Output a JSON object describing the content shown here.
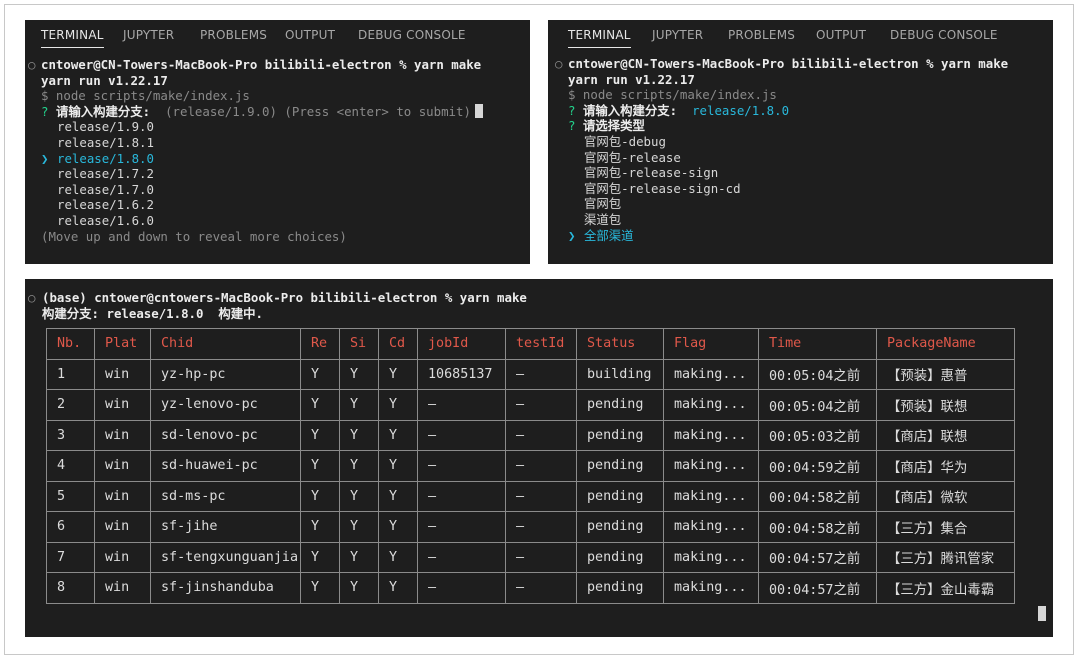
{
  "tabs": [
    "TERMINAL",
    "JUPYTER",
    "PROBLEMS",
    "OUTPUT",
    "DEBUG CONSOLE"
  ],
  "panel1": {
    "prompt": "cntower@CN-Towers-MacBook-Pro bilibili-electron % yarn make",
    "yarn": "yarn run v1.22.17",
    "node": "$ node scripts/make/index.js",
    "q_mark": "?",
    "question": "请输入构建分支:",
    "hint": "(release/1.9.0) (Press <enter> to submit)",
    "choices": [
      "release/1.9.0",
      "release/1.8.1",
      "release/1.8.0",
      "release/1.7.2",
      "release/1.7.0",
      "release/1.6.2",
      "release/1.6.0"
    ],
    "selected_marker": "❯",
    "more": "(Move up and down to reveal more choices)"
  },
  "panel2": {
    "prompt": "cntower@CN-Towers-MacBook-Pro bilibili-electron % yarn make",
    "yarn": "yarn run v1.22.17",
    "node": "$ node scripts/make/index.js",
    "q_mark": "?",
    "question1": "请输入构建分支:",
    "answer1": "release/1.8.0",
    "question2": "请选择类型",
    "choices": [
      "官网包-debug",
      "官网包-release",
      "官网包-release-sign",
      "官网包-release-sign-cd",
      "官网包",
      "渠道包"
    ],
    "selected_marker": "❯",
    "selected": "全部渠道"
  },
  "panel3": {
    "prompt": "(base) cntower@cntowers-MacBook-Pro bilibili-electron % yarn make",
    "status_line": "构建分支: release/1.8.0  构建中.",
    "headers": [
      "Nb.",
      "Plat",
      "Chid",
      "Re",
      "Si",
      "Cd",
      "jobId",
      "testId",
      "Status",
      "Flag",
      "Time",
      "PackageName"
    ],
    "rows": [
      [
        "1",
        "win",
        "yz-hp-pc",
        "Y",
        "Y",
        "Y",
        "10685137",
        "—",
        "building",
        "making...",
        "00:05:04之前",
        "【预装】惠普"
      ],
      [
        "2",
        "win",
        "yz-lenovo-pc",
        "Y",
        "Y",
        "Y",
        "—",
        "—",
        "pending",
        "making...",
        "00:05:04之前",
        "【预装】联想"
      ],
      [
        "3",
        "win",
        "sd-lenovo-pc",
        "Y",
        "Y",
        "Y",
        "—",
        "—",
        "pending",
        "making...",
        "00:05:03之前",
        "【商店】联想"
      ],
      [
        "4",
        "win",
        "sd-huawei-pc",
        "Y",
        "Y",
        "Y",
        "—",
        "—",
        "pending",
        "making...",
        "00:04:59之前",
        "【商店】华为"
      ],
      [
        "5",
        "win",
        "sd-ms-pc",
        "Y",
        "Y",
        "Y",
        "—",
        "—",
        "pending",
        "making...",
        "00:04:58之前",
        "【商店】微软"
      ],
      [
        "6",
        "win",
        "sf-jihe",
        "Y",
        "Y",
        "Y",
        "—",
        "—",
        "pending",
        "making...",
        "00:04:58之前",
        "【三方】集合"
      ],
      [
        "7",
        "win",
        "sf-tengxunguanjia",
        "Y",
        "Y",
        "Y",
        "—",
        "—",
        "pending",
        "making...",
        "00:04:57之前",
        "【三方】腾讯管家"
      ],
      [
        "8",
        "win",
        "sf-jinshanduba",
        "Y",
        "Y",
        "Y",
        "—",
        "—",
        "pending",
        "making...",
        "00:04:57之前",
        "【三方】金山毒霸"
      ]
    ]
  }
}
